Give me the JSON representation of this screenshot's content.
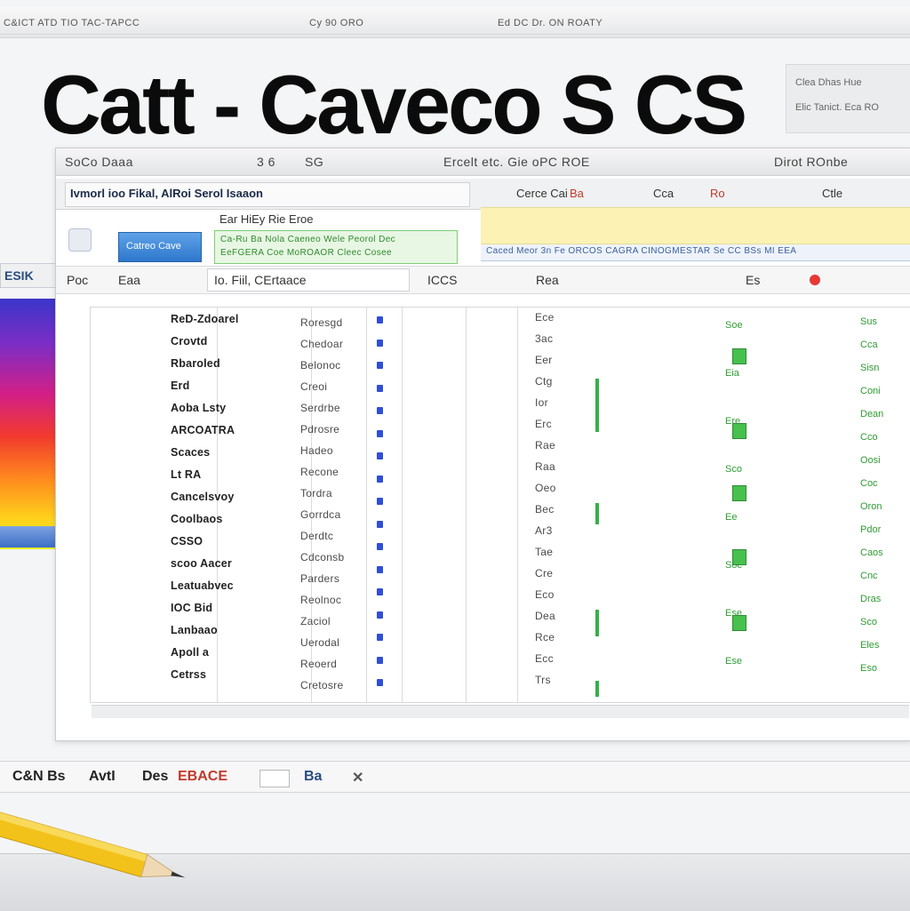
{
  "top_strip": {
    "left_text": "C&ICT ATD TIO TAC-TAPCC",
    "mid_text": "Cy 90 ORO",
    "right_text": "Ed DC Dr. ON ROATY"
  },
  "headline": {
    "text": "Catt - Caveco S CS",
    "badge_line_1": "Clea Dhas Hue",
    "badge_line_2": "Elic Tanict. Eca RO"
  },
  "window": {
    "title_items": [
      "SoCo Daaa",
      "3 6",
      "SG",
      "Ercelt etc. Gie oPC  ROE",
      "Dirot ROnbe"
    ],
    "menu_title": "Ivmorl ioo  Fikal, AlRoi Serol Isaaon",
    "menu_subtitle": "Ear HiEy Rie Eroe",
    "menu_right": [
      "Cerce Cai",
      "Ba",
      "Cca",
      "Ro",
      "Ctle"
    ],
    "blue_box_label": "Catreo Cave",
    "green_strip_lines": [
      "Ca-Ru Ba Nola Caeneo Wele Peorol Dec",
      "EeFGERA Coe MoROAOR Cleec Cosee"
    ],
    "blue_info_text": "Caced Meor 3n Fe ORCOS CAGRA CINOGMESTAR Se CC BSs MI EEA",
    "toolbar_items": [
      "Poc",
      "Eaa",
      "Io.  Fiil,  CErtaace",
      "ICCS",
      "Rea",
      "Es"
    ]
  },
  "columns": {
    "names": [
      "ReD-Zdoarel",
      "Crovtd",
      "Rbaroled",
      "Erd",
      "Aoba Lsty",
      "ARCOATRA",
      "Scaces",
      "Lt RA",
      "Cancelsvoy",
      "Coolbaos",
      "CSSO",
      "scoo Aacer",
      "Leatuabvec",
      "IOC Bid",
      "Lanbaao",
      "Apoll a",
      "Cetrss"
    ],
    "codes": [
      "Roresgd",
      "Chedoar",
      "Belonoc",
      "Creoi",
      "Serdrbe",
      "Pdrosre",
      "Hadeo",
      "Recone",
      "Tordra",
      "Gorrdca",
      "Derdtc",
      "Cdconsb",
      "Parders",
      "Reolnoc",
      "Zaciol",
      "Uerodal",
      "Reoerd",
      "Cretosre"
    ],
    "mid_codes": [
      "Ece",
      "3ac",
      "Eer",
      "Ctg",
      "Ior",
      "Erc",
      "Rae",
      "Raa",
      "Oeo",
      "Bec",
      "Ar3",
      "Tae",
      "Cre",
      "Eco",
      "Dea",
      "Rce",
      "Ecc",
      "Trs"
    ],
    "green_codes": [
      "Sus",
      "Cca",
      "Sisn",
      "Coni",
      "Dean",
      "Cco",
      "Oosi",
      "Coc",
      "Oron",
      "Pdor",
      "Caos",
      "Cnc",
      "Dras",
      "Sco",
      "Eles",
      "Eso"
    ],
    "green_mid": [
      "Soe",
      "Eia",
      "Ere",
      "Sco",
      "Ee",
      "Soc",
      "Ese",
      "Ese"
    ]
  },
  "left_panel": {
    "tab_label": "ESIK"
  },
  "bottom_bar": {
    "items": [
      "C&N Bs",
      "AvtI",
      "Des",
      "EBACE"
    ],
    "icon_label": "Ba"
  },
  "colors": {
    "accent_blue": "#2e77cc",
    "accent_green": "#35b04a",
    "highlight_yellow": "#fbf2b4",
    "record_red": "#e53935"
  }
}
